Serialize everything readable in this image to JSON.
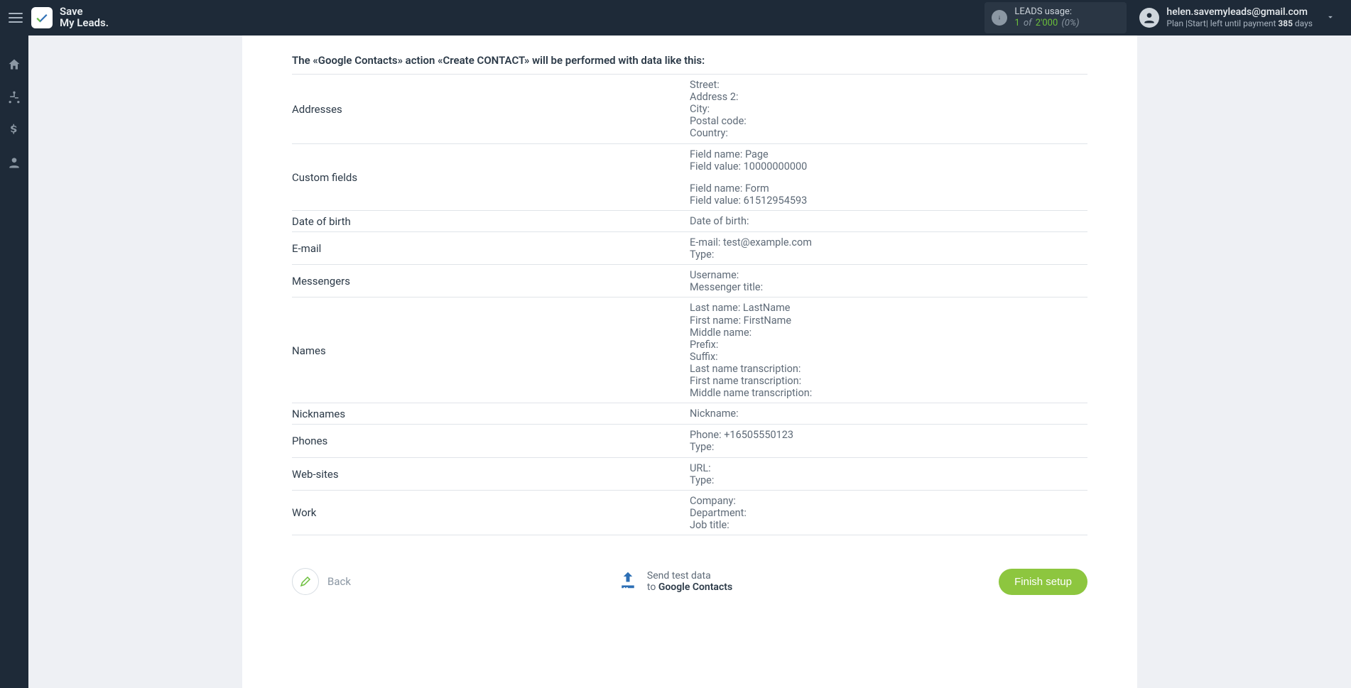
{
  "brand": {
    "line1": "Save",
    "line2": "My Leads."
  },
  "leads": {
    "title": "LEADS usage:",
    "used": "1",
    "of": "of",
    "total": "2'000",
    "pct": "(0%)"
  },
  "user": {
    "email": "helen.savemyleads@gmail.com",
    "plan_prefix": "Plan |Start| left until payment ",
    "plan_days_num": "385",
    "plan_days_suffix": " days"
  },
  "heading": "The «Google Contacts» action «Create CONTACT» will be performed with data like this:",
  "rows": [
    {
      "label": "Addresses",
      "groups": [
        {
          "lines": [
            "Street:",
            "Address 2:",
            "City:",
            "Postal code:",
            "Country:"
          ]
        }
      ]
    },
    {
      "label": "Custom fields",
      "groups": [
        {
          "lines": [
            "Field name: Page",
            "Field value: 10000000000"
          ]
        },
        {
          "lines": [
            "Field name: Form",
            "Field value: 61512954593"
          ]
        }
      ]
    },
    {
      "label": "Date of birth",
      "groups": [
        {
          "lines": [
            "Date of birth:"
          ]
        }
      ]
    },
    {
      "label": "E-mail",
      "groups": [
        {
          "lines": [
            "E-mail: test@example.com",
            "Type:"
          ]
        }
      ]
    },
    {
      "label": "Messengers",
      "groups": [
        {
          "lines": [
            "Username:",
            "Messenger title:"
          ]
        }
      ]
    },
    {
      "label": "Names",
      "groups": [
        {
          "lines": [
            "Last name: LastName",
            "First name: FirstName",
            "Middle name:",
            "Prefix:",
            "Suffix:",
            "Last name transcription:",
            "First name transcription:",
            "Middle name transcription:"
          ]
        }
      ]
    },
    {
      "label": "Nicknames",
      "groups": [
        {
          "lines": [
            "Nickname:"
          ]
        }
      ]
    },
    {
      "label": "Phones",
      "groups": [
        {
          "lines": [
            "Phone: +16505550123",
            "Type:"
          ]
        }
      ]
    },
    {
      "label": "Web-sites",
      "groups": [
        {
          "lines": [
            "URL:",
            "Type:"
          ]
        }
      ]
    },
    {
      "label": "Work",
      "groups": [
        {
          "lines": [
            "Company:",
            "Department:",
            "Job title:"
          ]
        }
      ]
    }
  ],
  "footer": {
    "back": "Back",
    "test_line1": "Send test data",
    "test_to": "to ",
    "test_target": "Google Contacts",
    "finish": "Finish setup"
  }
}
